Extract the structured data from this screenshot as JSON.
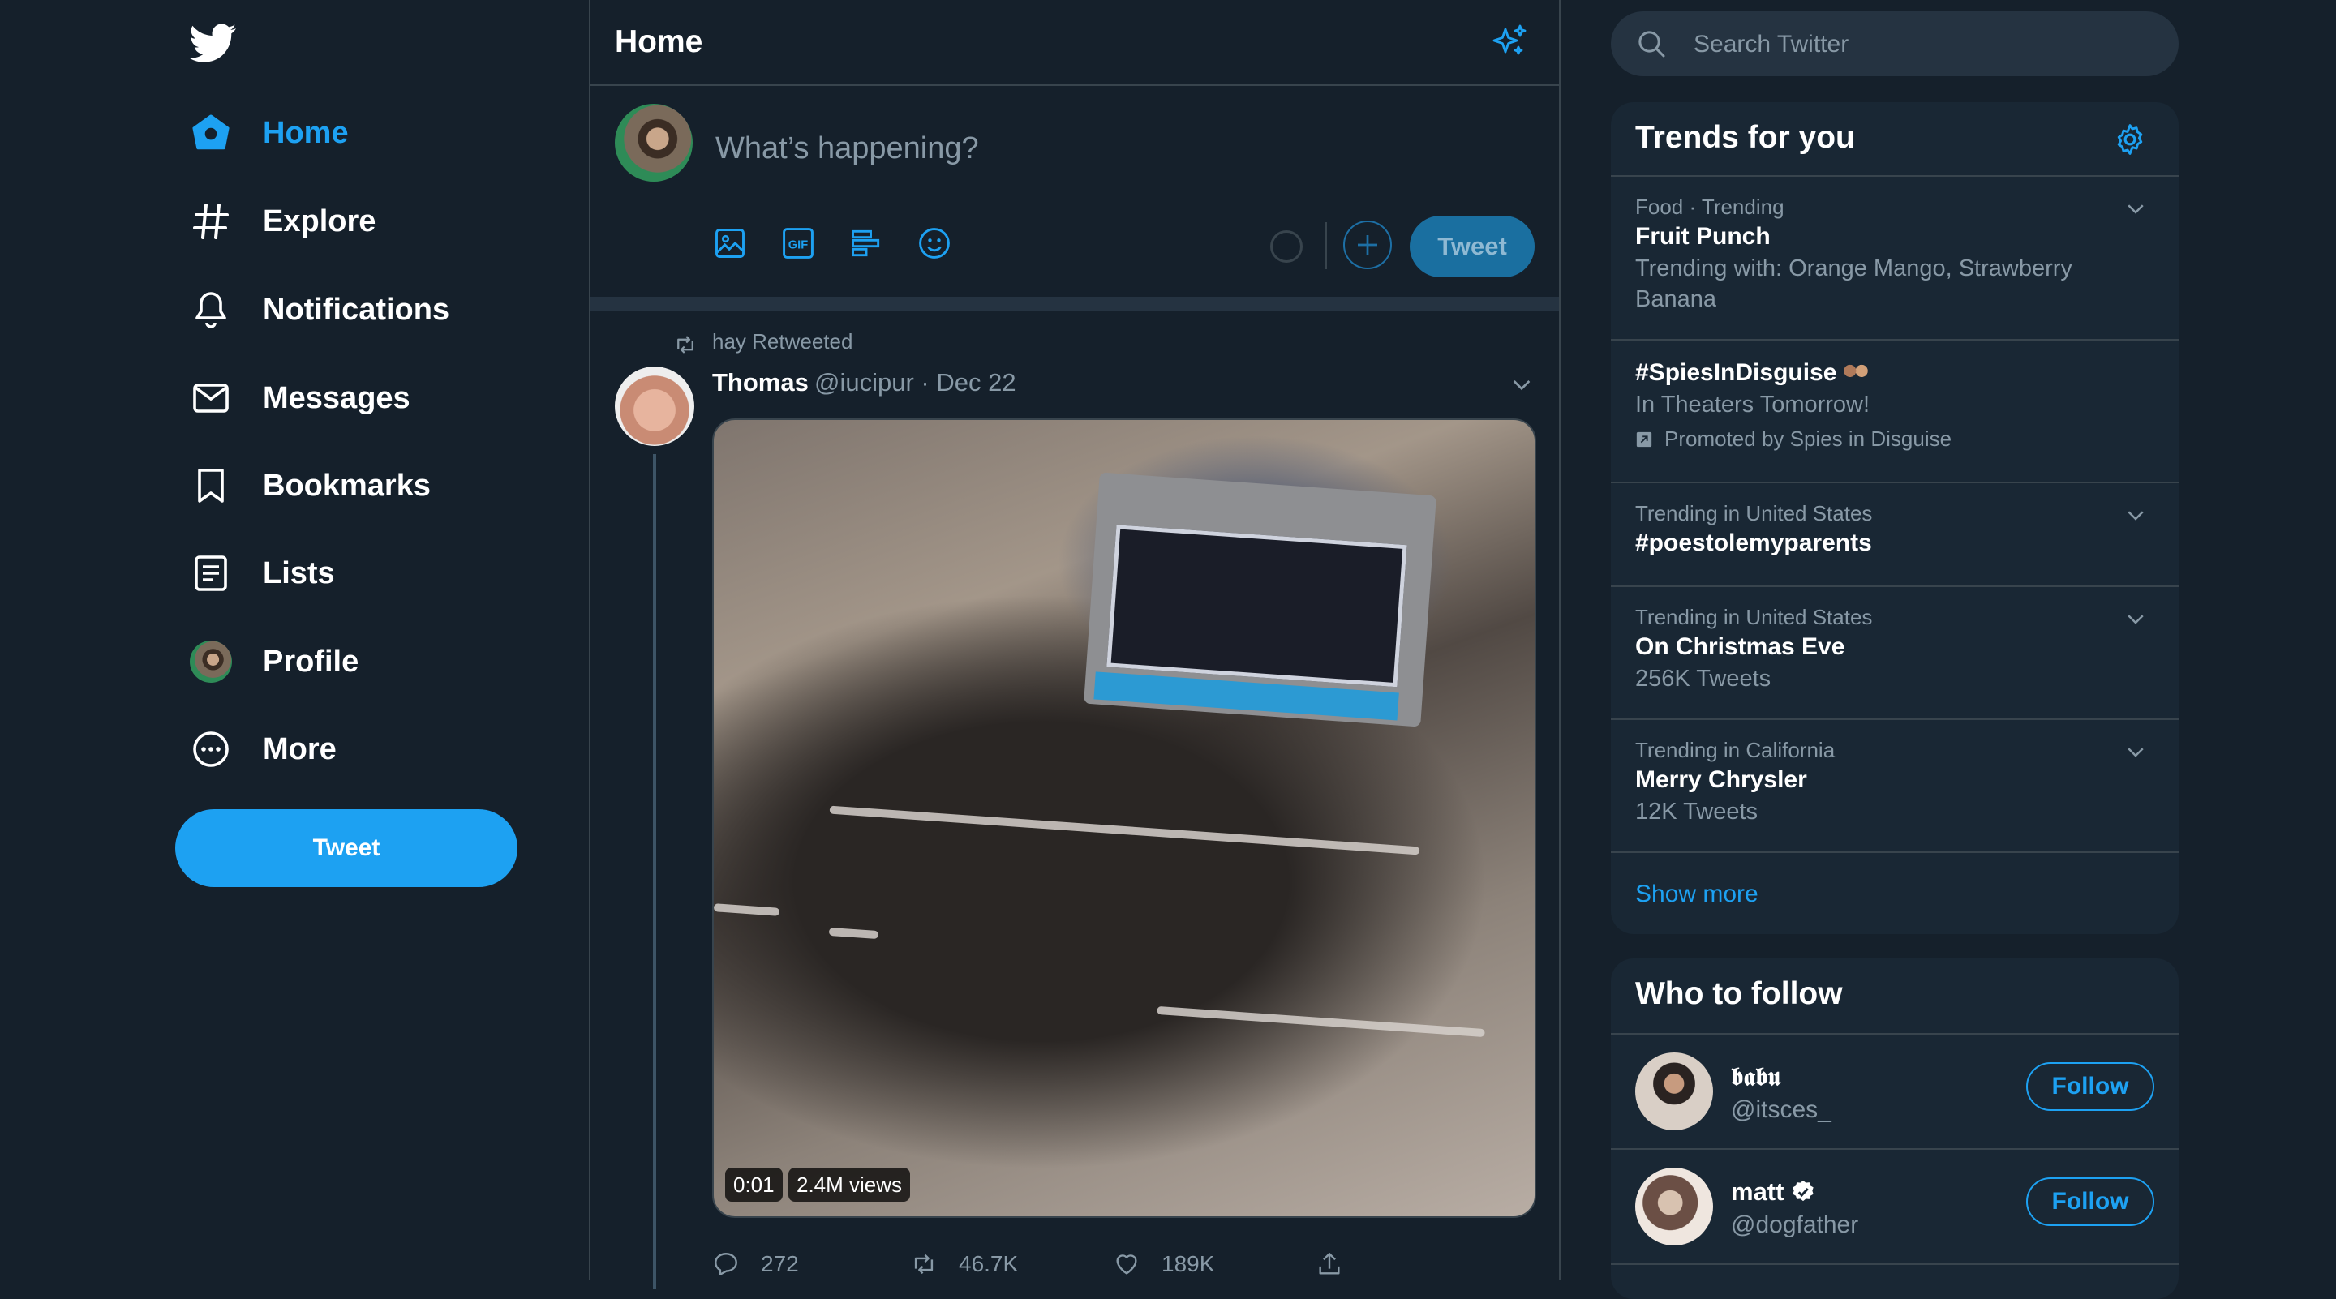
{
  "nav": {
    "items": [
      {
        "label": "Home",
        "icon": "home-icon"
      },
      {
        "label": "Explore",
        "icon": "hashtag-icon"
      },
      {
        "label": "Notifications",
        "icon": "bell-icon"
      },
      {
        "label": "Messages",
        "icon": "envelope-icon"
      },
      {
        "label": "Bookmarks",
        "icon": "bookmark-icon"
      },
      {
        "label": "Lists",
        "icon": "list-icon"
      },
      {
        "label": "Profile",
        "icon": "avatar"
      },
      {
        "label": "More",
        "icon": "more-icon"
      }
    ],
    "tweet_label": "Tweet",
    "accent": "#1da1f2"
  },
  "center": {
    "title": "Home",
    "compose": {
      "placeholder": "What’s happening?",
      "tweet_label": "Tweet"
    }
  },
  "tweet": {
    "retweeted_by": "hay Retweeted",
    "name": "Thomas",
    "handle_date": "@iucipur · Dec 22",
    "video_time": "0:01",
    "video_views": "2.4M views",
    "replies": "272",
    "retweets": "46.7K",
    "likes": "189K"
  },
  "search": {
    "placeholder": "Search Twitter"
  },
  "trends": {
    "title": "Trends for you",
    "items": [
      {
        "meta": "Food · Trending",
        "name": "Fruit Punch",
        "sub": "Trending with: Orange Mango, Strawberry Banana"
      },
      {
        "name": "#SpiesInDisguise",
        "sub": "In Theaters Tomorrow!",
        "promoted": "Promoted by Spies in Disguise"
      },
      {
        "meta": "Trending in United States",
        "name": "#poestolemyparents"
      },
      {
        "meta": "Trending in United States",
        "name": "On Christmas Eve",
        "sub": "256K Tweets"
      },
      {
        "meta": "Trending in California",
        "name": "Merry Chrysler",
        "sub": "12K Tweets"
      }
    ],
    "show_more": "Show more"
  },
  "who_to_follow": {
    "title": "Who to follow",
    "users": [
      {
        "name": "𝖇𝖆𝖇𝖚",
        "handle": "@itsces_",
        "follow_label": "Follow"
      },
      {
        "name": "matt",
        "handle": "@dogfather",
        "follow_label": "Follow",
        "verified": true
      }
    ]
  },
  "colors": {
    "background": "#15202b",
    "panel": "#192734",
    "border": "#38444d",
    "muted": "#8899a6",
    "accent": "#1da1f2"
  }
}
